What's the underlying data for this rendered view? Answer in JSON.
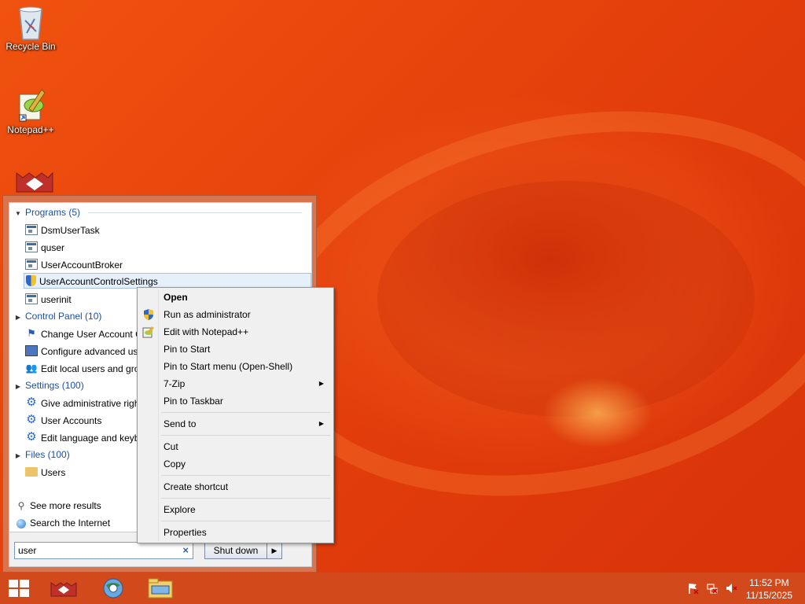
{
  "desktop": {
    "icons": [
      {
        "label": "Recycle Bin",
        "icon": "recycle-bin-icon"
      },
      {
        "label": "Notepad++",
        "icon": "notepad-plus-plus-icon"
      },
      {
        "label": "",
        "icon": "app-icon"
      }
    ]
  },
  "start_menu": {
    "categories": {
      "programs": "Programs (5)",
      "control_panel": "Control Panel (10)",
      "settings": "Settings (100)",
      "files": "Files (100)"
    },
    "programs": [
      "DsmUserTask",
      "quser",
      "UserAccountBroker",
      "UserAccountControlSettings",
      "userinit"
    ],
    "control_panel": [
      "Change User Account C",
      "Configure advanced us",
      "Edit local users and gro"
    ],
    "settings": [
      "Give administrative righ",
      "User Accounts",
      "Edit language and keyb"
    ],
    "files": [
      "Users"
    ],
    "see_more": "See more results",
    "search_internet": "Search the Internet",
    "search": {
      "value": "user",
      "clear": "×"
    },
    "shutdown": "Shut down",
    "shutdown_arrow": "▶"
  },
  "context_menu": {
    "open": "Open",
    "run_as_admin": "Run as administrator",
    "edit_notepad": "Edit with Notepad++",
    "pin_start": "Pin to Start",
    "pin_start_menu": "Pin to Start menu (Open-Shell)",
    "seven_zip": "7-Zip",
    "pin_taskbar": "Pin to Taskbar",
    "send_to": "Send to",
    "cut": "Cut",
    "copy": "Copy",
    "create_shortcut": "Create shortcut",
    "explore": "Explore",
    "properties": "Properties",
    "submenu_arrow": "▶"
  },
  "taskbar": {
    "time": "11:52 PM",
    "date": "11/15/2025",
    "apps": [
      "start-icon",
      "app-icon",
      "browser-icon",
      "file-explorer-icon"
    ]
  },
  "colors": {
    "desktop": "#e8430f",
    "taskbar": "#d24a1c",
    "start_frame": "#d8754f",
    "link_blue": "#1a4fa3"
  }
}
